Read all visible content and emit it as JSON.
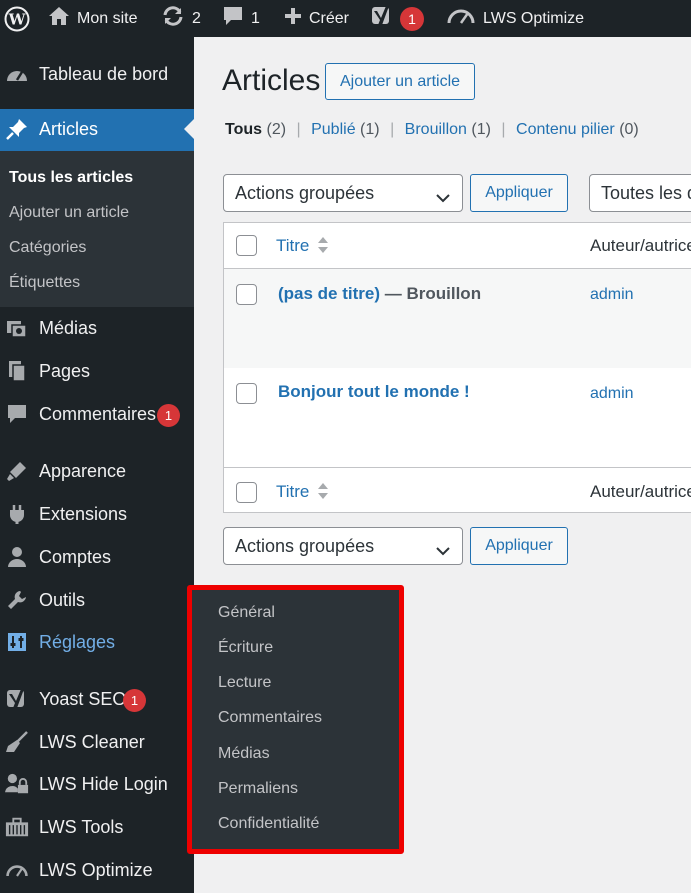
{
  "admin_bar": {
    "site_name": "Mon site",
    "updates_count": "2",
    "comments_count": "1",
    "new_label": "Créer",
    "yoast_badge": "1",
    "lws_optimize": "LWS Optimize"
  },
  "sidebar": {
    "dashboard": "Tableau de bord",
    "articles": "Articles",
    "submenu": {
      "all": "Tous les articles",
      "add": "Ajouter un article",
      "categories": "Catégories",
      "tags": "Étiquettes"
    },
    "media": "Médias",
    "pages": "Pages",
    "comments": "Commentaires",
    "comments_badge": "1",
    "appearance": "Apparence",
    "plugins": "Extensions",
    "users": "Comptes",
    "tools": "Outils",
    "settings": "Réglages",
    "yoast": "Yoast SEO",
    "yoast_badge": "1",
    "lws_cleaner": "LWS Cleaner",
    "lws_hide_login": "LWS Hide Login",
    "lws_tools": "LWS Tools",
    "lws_optimize": "LWS Optimize"
  },
  "settings_flyout": {
    "items": [
      "Général",
      "Écriture",
      "Lecture",
      "Commentaires",
      "Médias",
      "Permaliens",
      "Confidentialité"
    ]
  },
  "main": {
    "title": "Articles",
    "add_new": "Ajouter un article",
    "views": {
      "all_label": "Tous",
      "all_count": "(2)",
      "published_label": "Publié",
      "published_count": "(1)",
      "draft_label": "Brouillon",
      "draft_count": "(1)",
      "cornerstone_label": "Contenu pilier",
      "cornerstone_count": "(0)",
      "separator": "|"
    },
    "bulk_actions": "Actions groupées",
    "apply": "Appliquer",
    "date_filter": "Toutes les dates",
    "columns": {
      "title": "Titre",
      "author": "Auteur/autrice"
    },
    "posts": [
      {
        "title": "(pas de titre)",
        "state": " — Brouillon",
        "author": "admin"
      },
      {
        "title": "Bonjour tout le monde !",
        "state": "",
        "author": "admin"
      }
    ]
  },
  "colors": {
    "admin_dark": "#1d2327",
    "submenu_bg": "#2c3338",
    "accent_blue": "#2271b1",
    "highlight_red": "#ee0000",
    "badge_red": "#d63638"
  },
  "icons": [
    "wordpress-logo-icon",
    "home-icon",
    "updates-icon",
    "comment-icon",
    "plus-icon",
    "yoast-icon",
    "speedometer-icon",
    "dashboard-icon",
    "pin-icon",
    "media-icon",
    "pages-icon",
    "appearance-icon",
    "plugins-icon",
    "user-icon",
    "wrench-icon",
    "settings-icon",
    "broom-icon",
    "lock-user-icon",
    "toolbox-icon",
    "chevron-down-icon",
    "sort-arrows-icon"
  ]
}
